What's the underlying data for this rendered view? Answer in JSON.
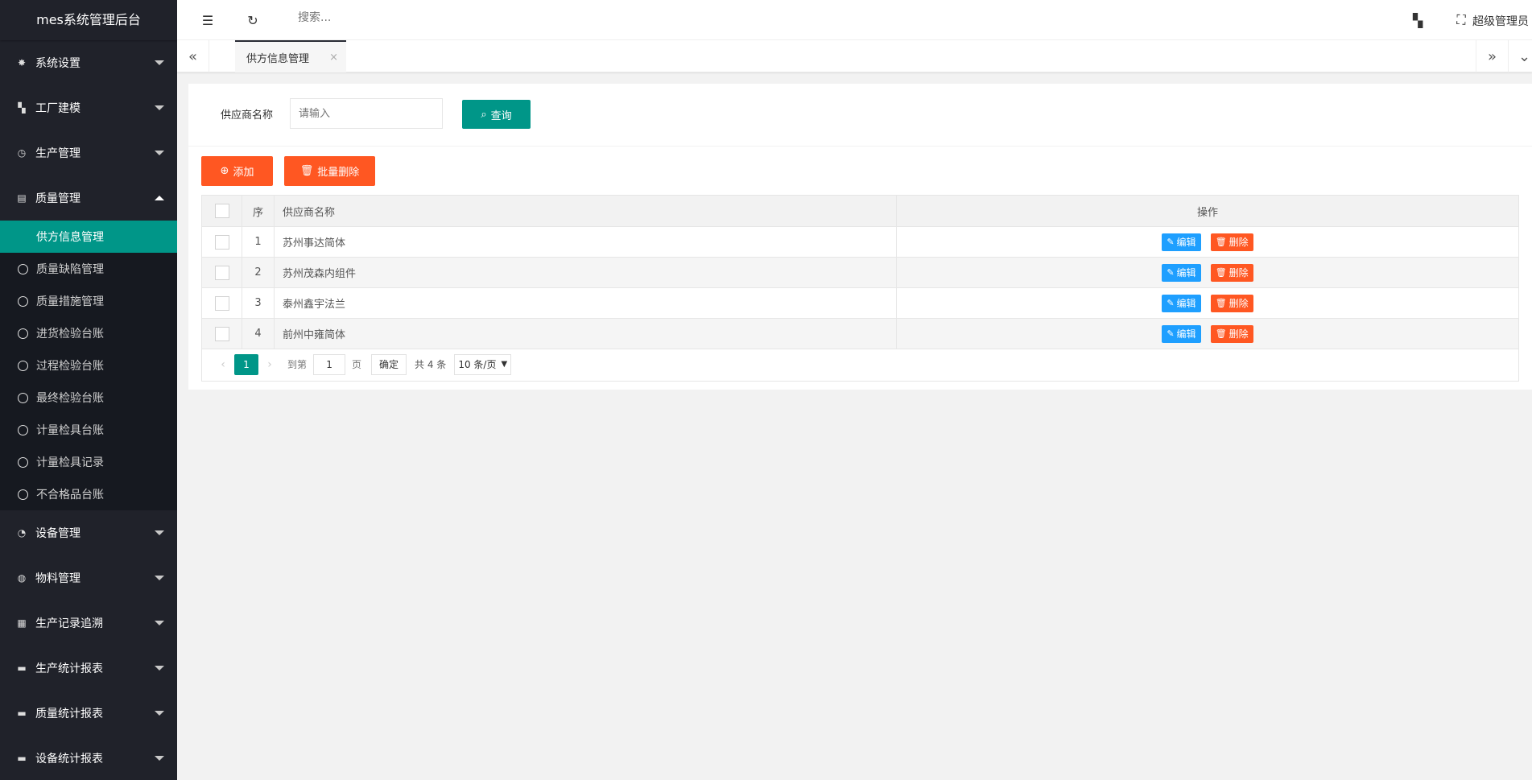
{
  "app": {
    "title": "mes系统管理后台"
  },
  "sidebar": {
    "menus": [
      {
        "label": "系统设置",
        "icon": "gear-icon",
        "expanded": false
      },
      {
        "label": "工厂建模",
        "icon": "apps-icon",
        "expanded": false
      },
      {
        "label": "生产管理",
        "icon": "clock-icon",
        "expanded": false
      },
      {
        "label": "质量管理",
        "icon": "doc-icon",
        "expanded": true
      }
    ],
    "submenu": [
      {
        "label": "供方信息管理",
        "active": true
      },
      {
        "label": "质量缺陷管理"
      },
      {
        "label": "质量措施管理"
      },
      {
        "label": "进货检验台账"
      },
      {
        "label": "过程检验台账"
      },
      {
        "label": "最终检验台账"
      },
      {
        "label": "计量检具台账"
      },
      {
        "label": "计量检具记录"
      },
      {
        "label": "不合格品台账"
      }
    ],
    "menus_after": [
      {
        "label": "设备管理",
        "icon": "gauge-icon"
      },
      {
        "label": "物料管理",
        "icon": "globe-icon"
      },
      {
        "label": "生产记录追溯",
        "icon": "table-icon"
      },
      {
        "label": "生产统计报表",
        "icon": "chart-icon"
      },
      {
        "label": "质量统计报表",
        "icon": "chart-icon"
      },
      {
        "label": "设备统计报表",
        "icon": "chart-icon"
      }
    ]
  },
  "header": {
    "search_placeholder": "搜索...",
    "user": "超级管理员"
  },
  "tabs": [
    {
      "label": "供方信息管理",
      "close": "×"
    }
  ],
  "filter": {
    "label": "供应商名称",
    "placeholder": "请输入",
    "query_button": "查询"
  },
  "toolbar": {
    "add": "添加",
    "batch_delete": "批量删除"
  },
  "table": {
    "headers": {
      "seq": "序",
      "name": "供应商名称",
      "op": "操作"
    },
    "rows": [
      {
        "seq": "1",
        "name": "苏州事达简体"
      },
      {
        "seq": "2",
        "name": "苏州茂森内组件"
      },
      {
        "seq": "3",
        "name": "泰州鑫宇法兰"
      },
      {
        "seq": "4",
        "name": "前州中雍简体"
      }
    ],
    "edit": "编辑",
    "delete": "删除"
  },
  "pager": {
    "current": "1",
    "goto_label": "到第",
    "page_input": "1",
    "page_unit": "页",
    "confirm": "确定",
    "total": "共 4 条",
    "page_size": "10 条/页"
  },
  "colors": {
    "sidebar_bg": "#20222a",
    "accent": "#009688",
    "danger": "#ff5722",
    "info": "#1e9fff"
  }
}
